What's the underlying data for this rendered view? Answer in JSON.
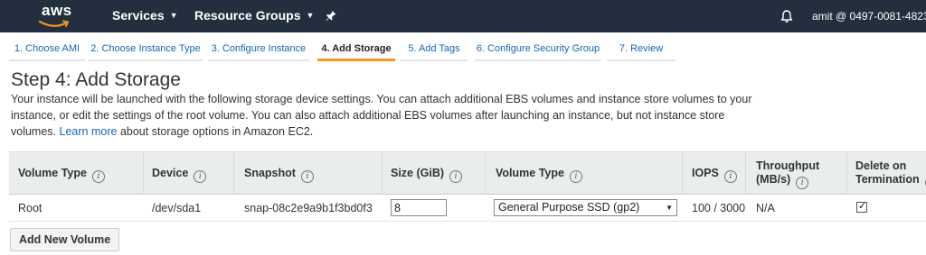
{
  "brand": {
    "logo_text": "aws",
    "nav_bg": "#232f3e",
    "accent": "#f7931e",
    "link": "#1166bb"
  },
  "nav": {
    "services_label": "Services",
    "resource_groups_label": "Resource Groups",
    "pin_icon": "pin-icon",
    "bell_icon": "bell-icon",
    "account_label": "amit @ 0497-0081-4823"
  },
  "wizard": {
    "active_index": 3,
    "tabs": [
      {
        "label": "1. Choose AMI"
      },
      {
        "label": "2. Choose Instance Type"
      },
      {
        "label": "3. Configure Instance"
      },
      {
        "label": "4. Add Storage"
      },
      {
        "label": "5. Add Tags"
      },
      {
        "label": "6. Configure Security Group"
      },
      {
        "label": "7. Review"
      }
    ]
  },
  "page": {
    "title": "Step 4: Add Storage",
    "description_part1": "Your instance will be launched with the following storage device settings. You can attach additional EBS volumes and instance store volumes to your instance, or edit the settings of the root volume. You can also attach additional EBS volumes after launching an instance, but not instance store volumes.",
    "learn_more_label": "Learn more",
    "description_part2": "about storage options in Amazon EC2."
  },
  "table": {
    "columns": {
      "volume_type": "Volume Type",
      "device": "Device",
      "snapshot": "Snapshot",
      "size": "Size (GiB)",
      "ebs_volume_type": "Volume Type",
      "iops": "IOPS",
      "throughput_line1": "Throughput",
      "throughput_line2": "(MB/s)",
      "delete_line1": "Delete on",
      "delete_line2": "Termination"
    },
    "rows": [
      {
        "volume_type": "Root",
        "device": "/dev/sda1",
        "snapshot": "snap-08c2e9a9b1f3bd0f3",
        "size": "8",
        "ebs_volume_type": "General Purpose SSD (gp2)",
        "iops": "100 / 3000",
        "throughput": "N/A",
        "delete_on_termination": true
      }
    ]
  },
  "actions": {
    "add_volume_label": "Add New Volume"
  }
}
